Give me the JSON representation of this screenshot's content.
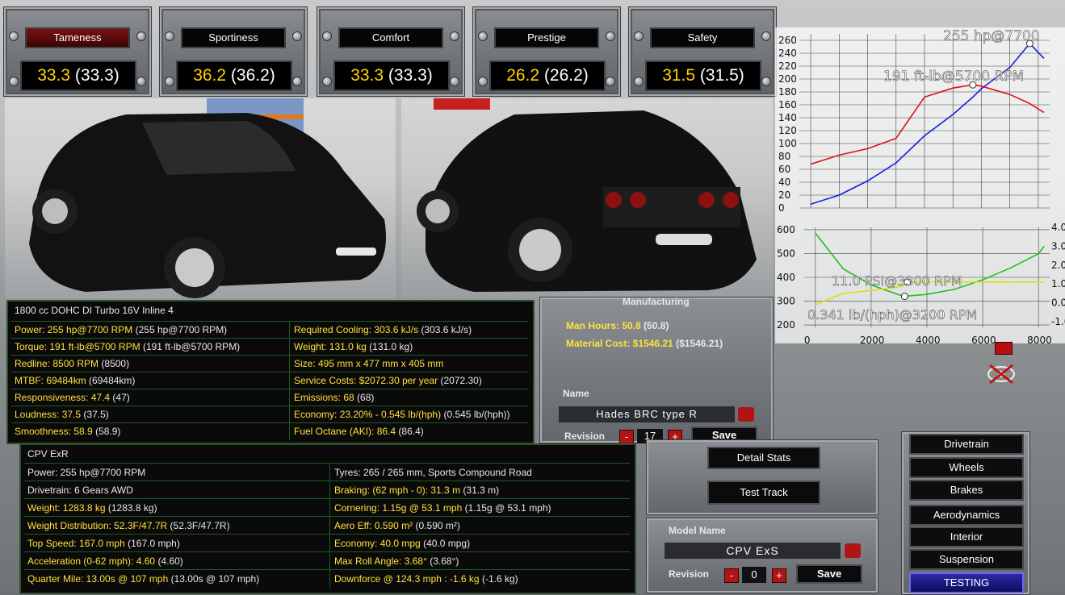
{
  "stats_bar": [
    {
      "label": "Tameness",
      "value": "33.3",
      "base": "(33.3)",
      "active": true
    },
    {
      "label": "Sportiness",
      "value": "36.2",
      "base": "(36.2)",
      "active": false
    },
    {
      "label": "Comfort",
      "value": "33.3",
      "base": "(33.3)",
      "active": false
    },
    {
      "label": "Prestige",
      "value": "26.2",
      "base": "(26.2)",
      "active": false
    },
    {
      "label": "Safety",
      "value": "31.5",
      "base": "(31.5)",
      "active": false
    }
  ],
  "engine": {
    "title": "1800 cc DOHC DI Turbo 16V Inline 4",
    "left": [
      {
        "text": "Power: 255 hp@7700 RPM",
        "base": "(255 hp@7700 RPM)"
      },
      {
        "text": "Torque: 191 ft-lb@5700 RPM",
        "base": "(191 ft-lb@5700 RPM)"
      },
      {
        "text": "Redline: 8500 RPM",
        "base": "(8500)"
      },
      {
        "text": "MTBF: 69484km",
        "base": "(69484km)"
      },
      {
        "text": "Responsiveness: 47.4",
        "base": "(47)"
      },
      {
        "text": "Loudness: 37.5",
        "base": "(37.5)"
      },
      {
        "text": "Smoothness: 58.9",
        "base": "(58.9)"
      }
    ],
    "right": [
      {
        "text": "Required Cooling: 303.6 kJ/s",
        "base": "(303.6 kJ/s)"
      },
      {
        "text": "Weight: 131.0 kg",
        "base": "(131.0 kg)"
      },
      {
        "text": "Size: 495 mm x 477 mm x 405 mm",
        "base": ""
      },
      {
        "text": "Service Costs: $2072.30 per year",
        "base": "(2072.30)"
      },
      {
        "text": "Emissions: 68",
        "base": "(68)"
      },
      {
        "text": "Economy: 23.20% - 0.545 lb/(hph)",
        "base": "(0.545 lb/(hph))"
      },
      {
        "text": "Fuel Octane (AKI): 86.4",
        "base": "(86.4)"
      }
    ]
  },
  "car": {
    "title": "CPV ExR",
    "left": [
      {
        "text": "Power: 255 hp@7700 RPM",
        "base": "",
        "color": "white"
      },
      {
        "text": "Drivetrain: 6 Gears AWD",
        "base": "",
        "color": "white"
      },
      {
        "text": "Weight: 1283.8 kg",
        "base": "(1283.8 kg)",
        "color": "yellow"
      },
      {
        "text": "Weight Distribution: 52.3F/47.7R",
        "base": "(52.3F/47.7R)",
        "color": "yellow"
      },
      {
        "text": "Top Speed: 167.0 mph",
        "base": "(167.0 mph)",
        "color": "yellow"
      },
      {
        "text": "Acceleration (0-62 mph): 4.60",
        "base": "(4.60)",
        "color": "yellow"
      },
      {
        "text": "Quarter Mile: 13.00s @ 107 mph",
        "base": "(13.00s @ 107 mph)",
        "color": "yellow"
      }
    ],
    "right": [
      {
        "text": "Tyres: 265 / 265 mm, Sports Compound Road",
        "base": "",
        "color": "white"
      },
      {
        "text": "Braking: (62 mph - 0): 31.3 m",
        "base": "(31.3 m)",
        "color": "yellow"
      },
      {
        "text": "Cornering: 1.15g @ 53.1 mph",
        "base": "(1.15g @ 53.1 mph)",
        "color": "yellow"
      },
      {
        "text": "Aero Eff: 0.590 m²",
        "base": "(0.590 m²)",
        "color": "yellow"
      },
      {
        "text": "Economy: 40.0 mpg",
        "base": "(40.0 mpg)",
        "color": "yellow"
      },
      {
        "text": "Max Roll Angle: 3.68°",
        "base": "(3.68°)",
        "color": "yellow"
      },
      {
        "text": "Downforce @ 124.3 mph : -1.6 kg",
        "base": "(-1.6 kg)",
        "color": "yellow"
      }
    ]
  },
  "manufacturing": {
    "title": "Manufacturing",
    "man_hours": "Man Hours: 50.8",
    "man_hours_base": "(50.8)",
    "material_cost": "Material Cost: $1546.21",
    "material_cost_base": "($1546.21)",
    "name_label": "Name",
    "name_value": "Hades BRC type R",
    "revision_label": "Revision",
    "revision_value": "17",
    "save_label": "Save",
    "minus": "-",
    "plus": "+"
  },
  "actions": {
    "detail_stats": "Detail Stats",
    "test_track": "Test Track"
  },
  "model": {
    "label": "Model Name",
    "value": "CPV ExS",
    "revision_label": "Revision",
    "revision_value": "0",
    "save_label": "Save",
    "minus": "-",
    "plus": "+"
  },
  "side_menu": [
    "Drivetrain",
    "Wheels",
    "Brakes",
    "Aerodynamics",
    "Interior",
    "Suspension",
    "TESTING"
  ],
  "chart_data": [
    {
      "type": "line",
      "title": "",
      "x": [
        0,
        1000,
        2000,
        3000,
        4000,
        5000,
        5700,
        6000,
        7000,
        7700,
        8200
      ],
      "yticks": [
        0,
        20,
        40,
        60,
        80,
        100,
        120,
        140,
        160,
        180,
        200,
        220,
        240,
        260
      ],
      "ylim": [
        0,
        270
      ],
      "xlim": [
        -400,
        8400
      ],
      "annotations": [
        "255 hp@7700",
        "191 ft-lb@5700 RPM"
      ],
      "series": [
        {
          "color": "#1020e0",
          "values": [
            6,
            20,
            42,
            70,
            112,
            145,
            172,
            185,
            218,
            255,
            232
          ]
        },
        {
          "color": "#e01010",
          "values": [
            68,
            82,
            92,
            108,
            172,
            186,
            191,
            189,
            176,
            162,
            148
          ]
        }
      ]
    },
    {
      "type": "line",
      "title": "",
      "x": [
        0,
        1000,
        2000,
        3000,
        3200,
        3300,
        4000,
        5000,
        6000,
        7000,
        8000,
        8200
      ],
      "xticks": [
        0,
        2000,
        4000,
        6000,
        8000
      ],
      "yticks_left": [
        200,
        300,
        400,
        500,
        600
      ],
      "yticks_right": [
        -1.0,
        0.0,
        1.0,
        2.0,
        3.0,
        4.0
      ],
      "ylim_left": [
        190,
        610
      ],
      "ylim_right": [
        -1.3,
        4.0
      ],
      "annotations": [
        "11.0 PSI@3300 RPM",
        "0.341 lb/(hph)@3200 RPM"
      ],
      "series": [
        {
          "color": "#20c020",
          "values": [
            3.7,
            1.8,
            0.95,
            0.42,
            0.341,
            0.36,
            0.45,
            0.72,
            1.22,
            1.85,
            2.6,
            3.0
          ]
        },
        {
          "color": "#e0e000",
          "values": [
            -0.1,
            0.5,
            0.65,
            0.85,
            0.95,
            1.1,
            1.1,
            1.1,
            1.1,
            1.1,
            1.1,
            1.1
          ]
        }
      ]
    }
  ]
}
